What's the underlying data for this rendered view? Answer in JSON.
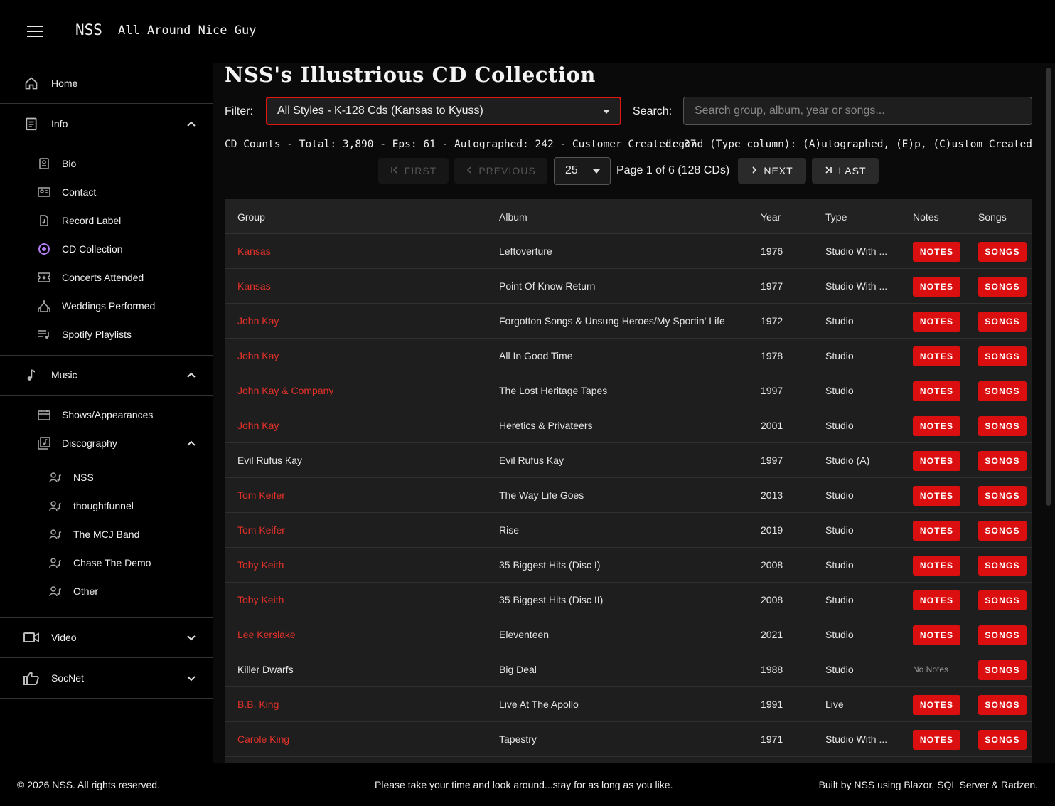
{
  "header": {
    "brand": "NSS",
    "tagline": "All Around Nice Guy"
  },
  "sidebar": {
    "home": "Home",
    "info": {
      "label": "Info",
      "items": [
        "Bio",
        "Contact",
        "Record Label",
        "CD Collection",
        "Concerts Attended",
        "Weddings Performed",
        "Spotify Playlists"
      ]
    },
    "music": {
      "label": "Music",
      "items": [
        "Shows/Appearances",
        "Discography"
      ],
      "discography_items": [
        "NSS",
        "thoughtfunnel",
        "The MCJ Band",
        "Chase The Demo",
        "Other"
      ]
    },
    "video": "Video",
    "socnet": "SocNet"
  },
  "main": {
    "title": "NSS's Illustrious CD Collection",
    "filter_label": "Filter:",
    "filter_value": "All Styles - K-128 Cds (Kansas to Kyuss)",
    "search_label": "Search:",
    "search_placeholder": "Search group, album, year or songs...",
    "counts": "CD Counts - Total: 3,890 - Eps: 61 - Autographed: 242 - Customer Created: 37",
    "legend": "Legend (Type column): (A)utographed, (E)p, (C)ustom Created",
    "pager": {
      "first": "FIRST",
      "previous": "PREVIOUS",
      "page_size": "25",
      "page_info": "Page 1 of 6 (128 CDs)",
      "next": "NEXT",
      "last": "LAST"
    },
    "table": {
      "headers": [
        "Group",
        "Album",
        "Year",
        "Type",
        "Notes",
        "Songs"
      ],
      "notes_label": "NOTES",
      "songs_label": "SONGS",
      "no_notes_label": "No Notes",
      "rows": [
        {
          "group": "Kansas",
          "album": "Leftoverture",
          "year": "1976",
          "type": "Studio With ...",
          "linked": true,
          "has_notes": true
        },
        {
          "group": "Kansas",
          "album": "Point Of Know Return",
          "year": "1977",
          "type": "Studio With ...",
          "linked": true,
          "has_notes": true
        },
        {
          "group": "John Kay",
          "album": "Forgotton Songs & Unsung Heroes/My Sportin' Life",
          "year": "1972",
          "type": "Studio",
          "linked": true,
          "has_notes": true
        },
        {
          "group": "John Kay",
          "album": "All In Good Time",
          "year": "1978",
          "type": "Studio",
          "linked": true,
          "has_notes": true
        },
        {
          "group": "John Kay & Company",
          "album": "The Lost Heritage Tapes",
          "year": "1997",
          "type": "Studio",
          "linked": true,
          "has_notes": true
        },
        {
          "group": "John Kay",
          "album": "Heretics & Privateers",
          "year": "2001",
          "type": "Studio",
          "linked": true,
          "has_notes": true
        },
        {
          "group": "Evil Rufus Kay",
          "album": "Evil Rufus Kay",
          "year": "1997",
          "type": "Studio (A)",
          "linked": false,
          "has_notes": true
        },
        {
          "group": "Tom Keifer",
          "album": "The Way Life Goes",
          "year": "2013",
          "type": "Studio",
          "linked": true,
          "has_notes": true
        },
        {
          "group": "Tom Keifer",
          "album": "Rise",
          "year": "2019",
          "type": "Studio",
          "linked": true,
          "has_notes": true
        },
        {
          "group": "Toby Keith",
          "album": "35 Biggest Hits (Disc I)",
          "year": "2008",
          "type": "Studio",
          "linked": true,
          "has_notes": true
        },
        {
          "group": "Toby Keith",
          "album": "35 Biggest Hits (Disc II)",
          "year": "2008",
          "type": "Studio",
          "linked": true,
          "has_notes": true
        },
        {
          "group": "Lee Kerslake",
          "album": "Eleventeen",
          "year": "2021",
          "type": "Studio",
          "linked": true,
          "has_notes": true
        },
        {
          "group": "Killer Dwarfs",
          "album": "Big Deal",
          "year": "1988",
          "type": "Studio",
          "linked": false,
          "has_notes": false
        },
        {
          "group": "B.B. King",
          "album": "Live At The Apollo",
          "year": "1991",
          "type": "Live",
          "linked": true,
          "has_notes": true
        },
        {
          "group": "Carole King",
          "album": "Tapestry",
          "year": "1971",
          "type": "Studio With ...",
          "linked": true,
          "has_notes": true
        }
      ]
    }
  },
  "footer": {
    "copyright": "© 2026 NSS. All rights reserved.",
    "message": "Please take your time and look around...stay for as long as you like.",
    "built_by": "Built by NSS using Blazor, SQL Server & Radzen."
  },
  "colors": {
    "accent": "#dc0f10",
    "link": "#e4312a",
    "active_nav": "#b07cf0"
  }
}
